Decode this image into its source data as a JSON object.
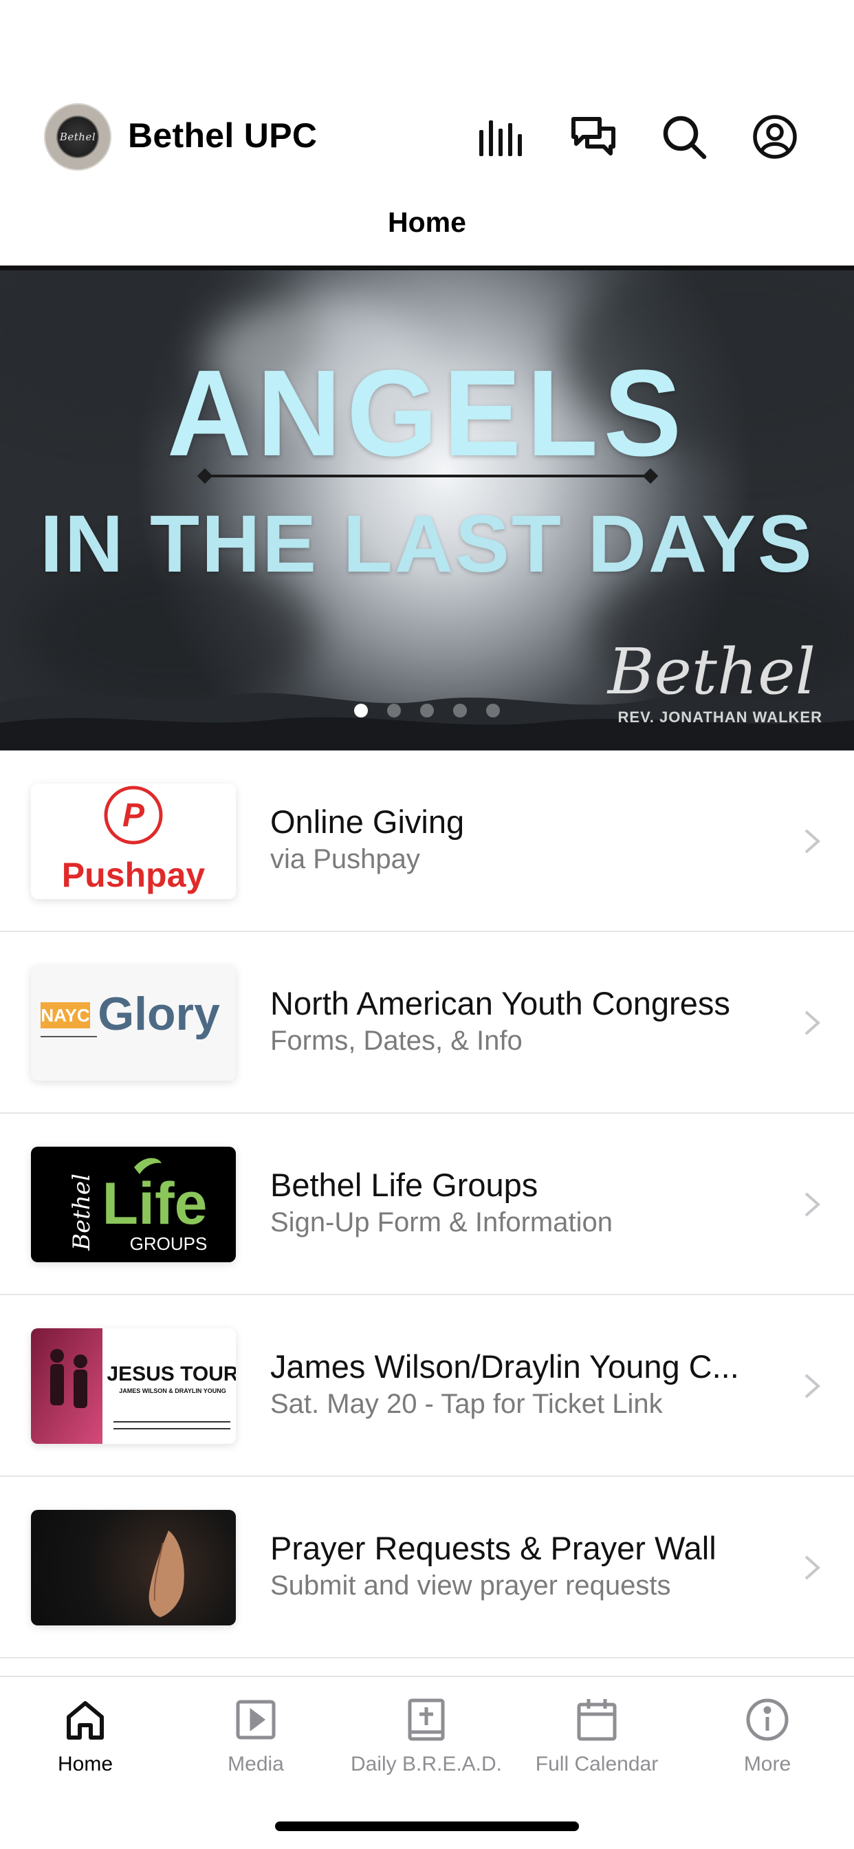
{
  "header": {
    "logo_text": "Bethel",
    "app_title": "Bethel UPC",
    "icons": [
      "audio-bars-icon",
      "chat-icon",
      "search-icon",
      "profile-icon"
    ]
  },
  "page_tab": "Home",
  "hero": {
    "title_line1": "ANGELS",
    "title_line2": "IN THE LAST DAYS",
    "watermark": "Bethel",
    "watermark_sub": "REV. JONATHAN WALKER",
    "carousel_count": 5,
    "carousel_active": 1,
    "colors": {
      "title": "#bfeff8"
    }
  },
  "list": {
    "items": [
      {
        "title": "Online Giving",
        "subtitle": "via Pushpay",
        "thumb": {
          "brand": "Pushpay",
          "mark": "P"
        }
      },
      {
        "title": "North American Youth Congress",
        "subtitle": "Forms, Dates, & Info",
        "thumb": {
          "badge": "NAYC",
          "word": "Glory"
        }
      },
      {
        "title": "Bethel Life Groups",
        "subtitle": "Sign-Up Form & Information",
        "thumb": {
          "script": "Bethel",
          "word": "Life",
          "sub": "GROUPS"
        }
      },
      {
        "title": "James Wilson/Draylin Young C...",
        "subtitle": "Sat. May 20 - Tap for Ticket Link",
        "thumb": {
          "headline": "JESUS TOUR",
          "names": "JAMES WILSON & DRAYLIN YOUNG"
        }
      },
      {
        "title": "Prayer Requests & Prayer Wall",
        "subtitle": "Submit and view prayer requests",
        "thumb": {}
      }
    ]
  },
  "tabbar": {
    "items": [
      {
        "label": "Home",
        "icon": "home-icon",
        "active": true
      },
      {
        "label": "Media",
        "icon": "play-square-icon",
        "active": false
      },
      {
        "label": "Daily B.R.E.A.D.",
        "icon": "bible-icon",
        "active": false
      },
      {
        "label": "Full Calendar",
        "icon": "calendar-icon",
        "active": false
      },
      {
        "label": "More",
        "icon": "info-icon",
        "active": false
      }
    ]
  },
  "colors": {
    "accent": "#000000",
    "inactive": "#8e8e93",
    "pushpay_red": "#e02a2a",
    "glory_blue": "#4d6a85",
    "life_green": "#8ac65a"
  }
}
